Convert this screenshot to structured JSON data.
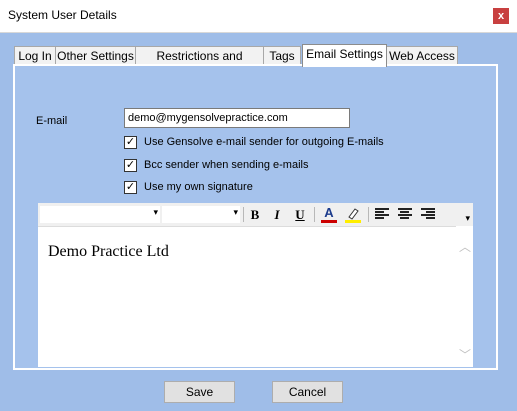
{
  "window": {
    "title": "System User Details",
    "close_label": "x"
  },
  "tabs": [
    {
      "label": "Log In"
    },
    {
      "label": "Other Settings"
    },
    {
      "label": "Restrictions and Security"
    },
    {
      "label": "Tags"
    },
    {
      "label": "Email Settings",
      "active": true
    },
    {
      "label": "Web Access"
    }
  ],
  "email": {
    "label": "E-mail",
    "value": "demo@mygensolvepractice.com"
  },
  "options": [
    {
      "label": "Use Gensolve e-mail sender for outgoing E-mails",
      "checked": true
    },
    {
      "label": "Bcc sender when sending e-mails",
      "checked": true
    },
    {
      "label": "Use my  own signature",
      "checked": true
    }
  ],
  "editor": {
    "content": "Demo Practice Ltd",
    "toolbar": {
      "bold_label": "B",
      "italic_label": "I",
      "underline_label": "U",
      "font_color_label": "A",
      "font_color": "#cc0000",
      "highlight_color": "#ffee00"
    }
  },
  "buttons": {
    "save_label": "Save",
    "cancel_label": "Cancel"
  }
}
